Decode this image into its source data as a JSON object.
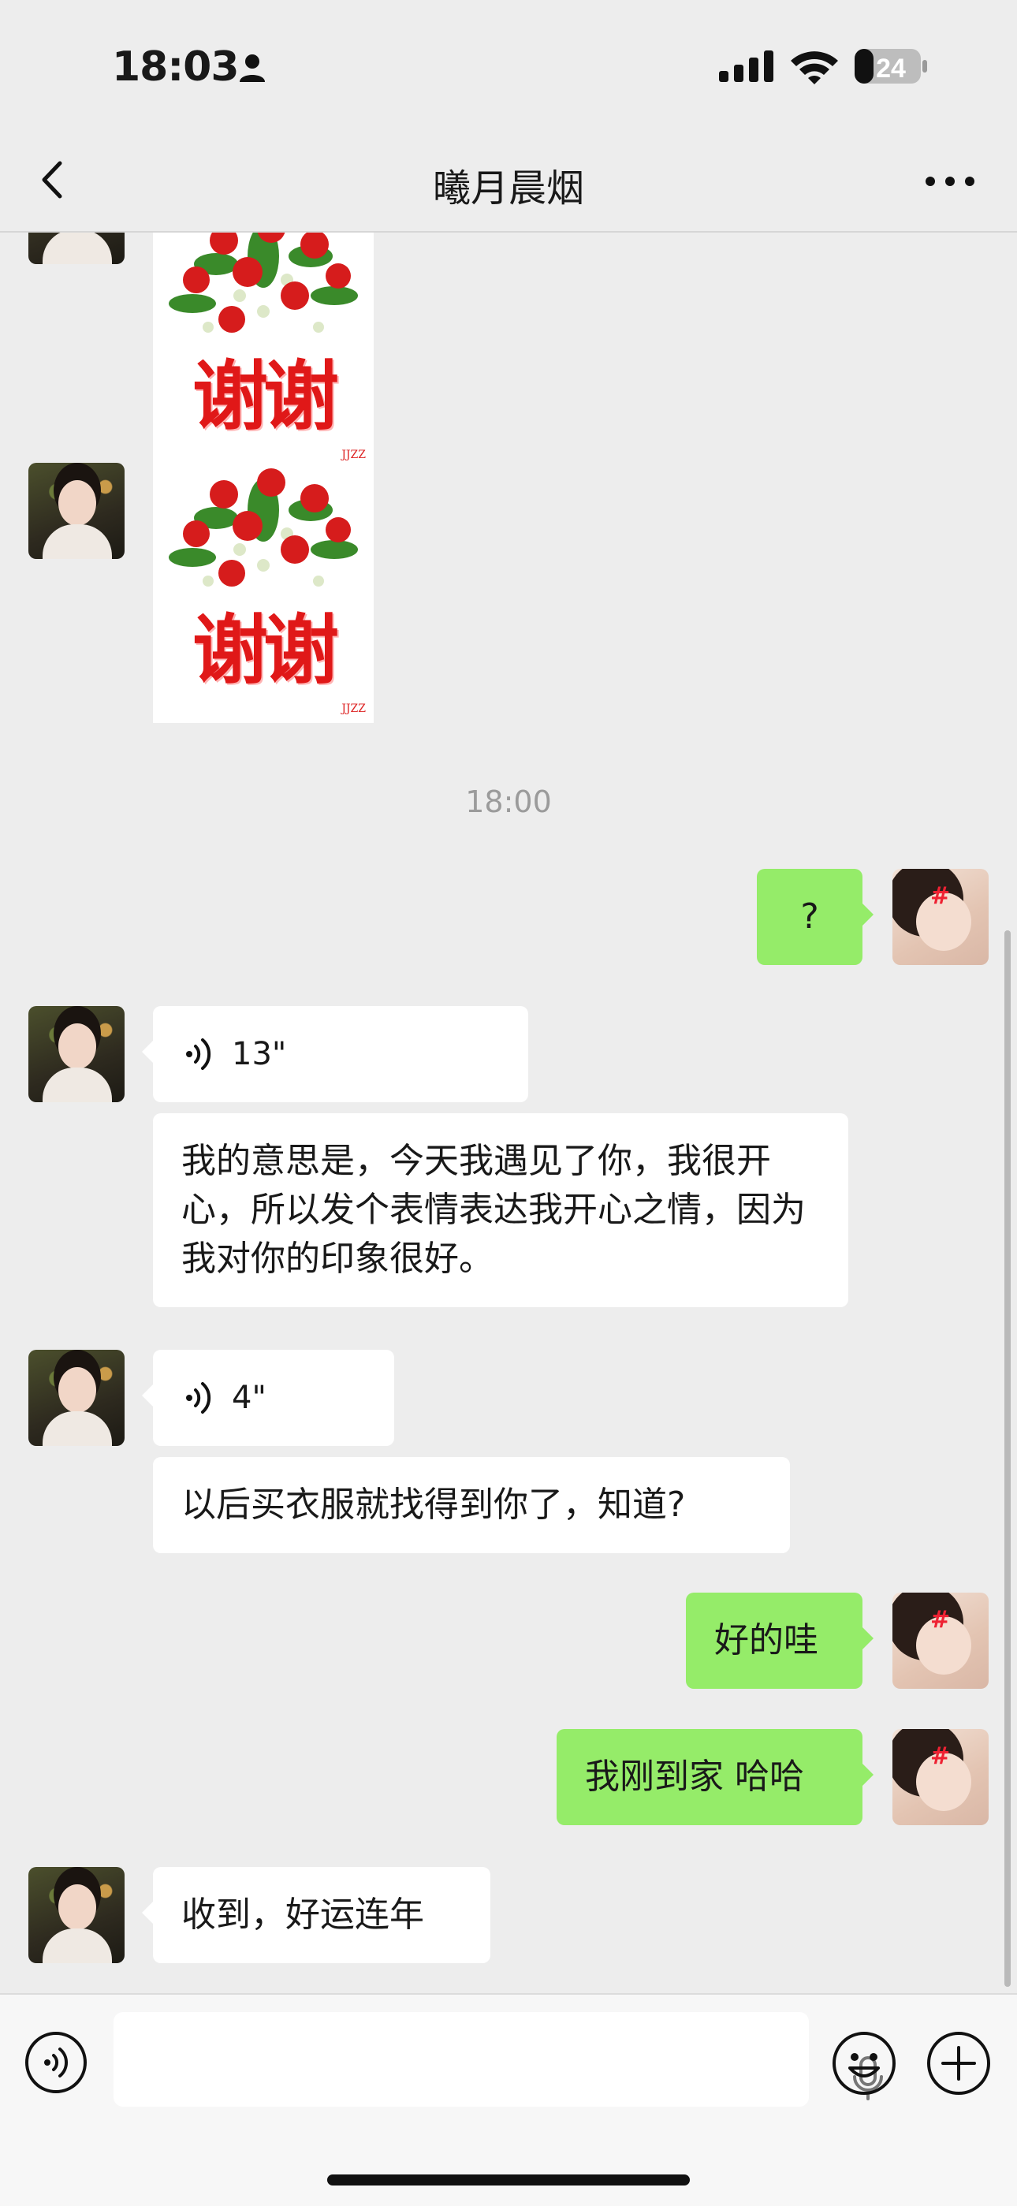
{
  "status_bar": {
    "time": "18:03",
    "battery": "24"
  },
  "nav": {
    "title": "曦月晨烟"
  },
  "sticker": {
    "text": "谢谢",
    "mark": "JJZZ"
  },
  "messages": {
    "timestamp": "18:00",
    "me_1": "?",
    "voice_1": "13\"",
    "them_1": "我的意思是，今天我遇见了你，我很开心，所以发个表情表达我开心之情，因为我对你的印象很好。",
    "voice_2": "4\"",
    "them_2": "以后买衣服就找得到你了，知道?",
    "me_2": "好的哇",
    "me_3": "我刚到家 哈哈",
    "them_3": "收到，好运连年"
  },
  "colors": {
    "me_bubble": "#95ec69",
    "them_bubble": "#ffffff",
    "background": "#ededed"
  }
}
